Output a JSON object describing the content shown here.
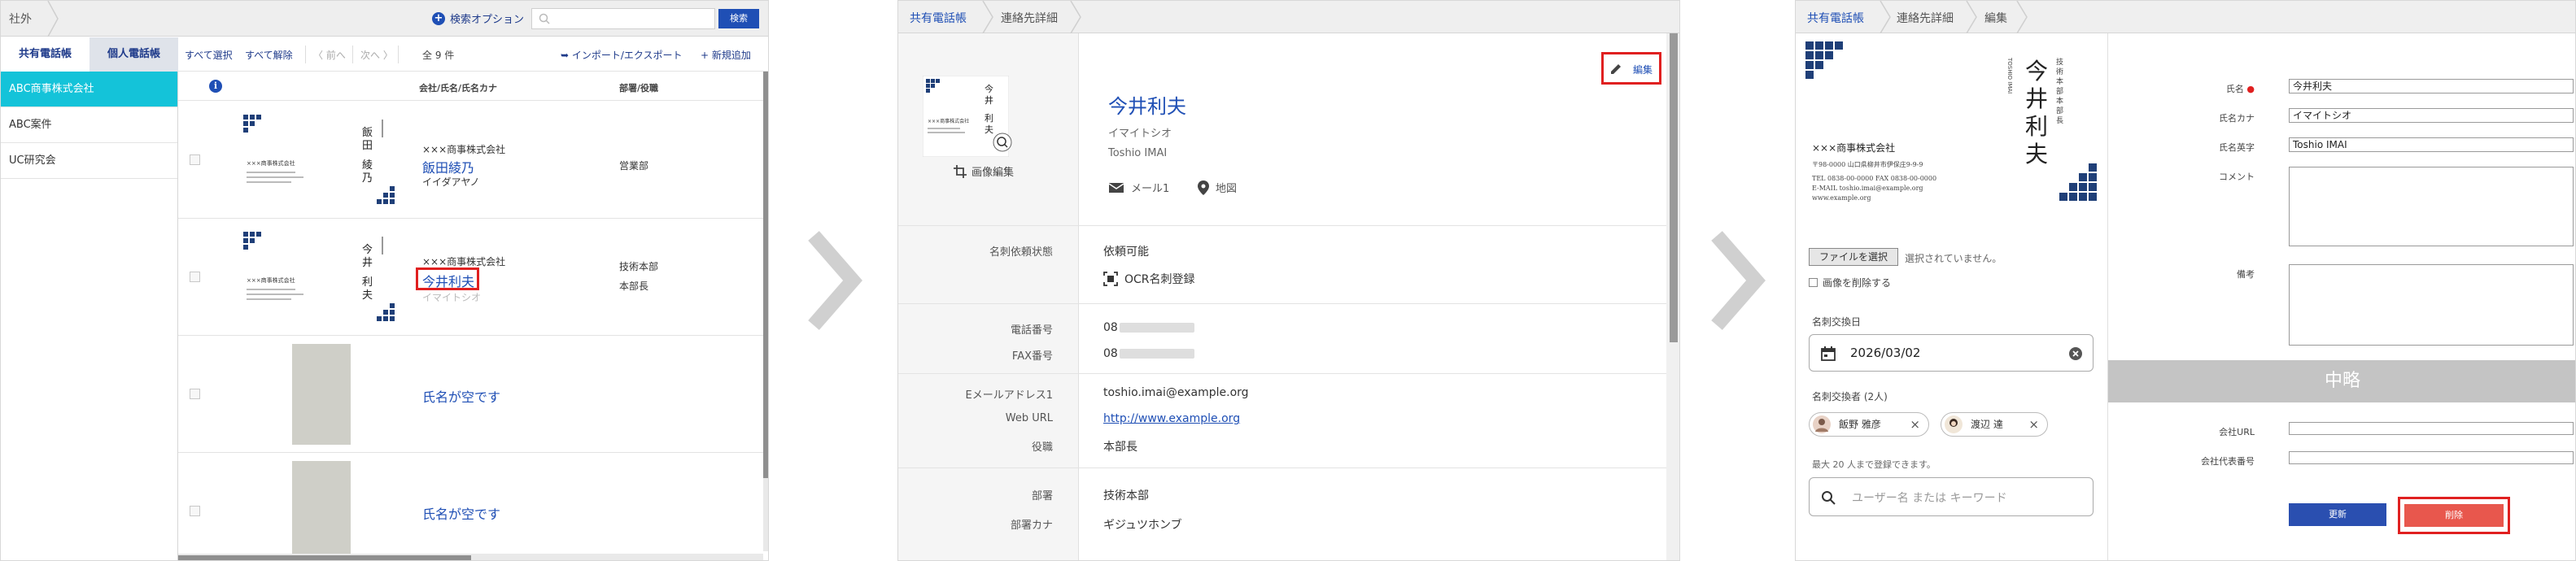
{
  "panel1": {
    "breadcrumb": "社外",
    "search_option_label": "検索オプション",
    "search_button": "検索",
    "tabs": [
      "共有電話帳",
      "個人電話帳"
    ],
    "sidebar": [
      "ABC商事株式会社",
      "ABC案件",
      "UC研究会"
    ],
    "toolbar": {
      "select_all": "すべて選択",
      "deselect_all": "すべて解除",
      "prev": "〈 前へ",
      "next": "次へ 〉",
      "count": "全 9 件",
      "import_export": "インポート/エクスポート",
      "add_new": "新規追加"
    },
    "columns": {
      "company": "会社/氏名/氏名カナ",
      "dept": "部署/役職"
    },
    "rows": [
      {
        "company": "×××商事株式会社",
        "name": "飯田綾乃",
        "kana": "イイダアヤノ",
        "dept": "営業部",
        "title": "",
        "card_name": "飯田 綾乃"
      },
      {
        "company": "×××商事株式会社",
        "name": "今井利夫",
        "kana": "イマイトシオ",
        "dept": "技術本部",
        "title": "本部長",
        "card_name": "今井 利夫"
      },
      {
        "company": "",
        "name": "氏名が空です",
        "kana": "",
        "dept": "",
        "title": ""
      },
      {
        "company": "",
        "name": "氏名が空です",
        "kana": "",
        "dept": "",
        "title": ""
      }
    ]
  },
  "panel2": {
    "breadcrumb": [
      "共有電話帳",
      "連絡先詳細"
    ],
    "edit": "編集",
    "image_edit": "画像編集",
    "name": "今井利夫",
    "kana": "イマイトシオ",
    "romaji": "Toshio IMAI",
    "mail": "メール1",
    "map": "地図",
    "fields": [
      {
        "label": "名刺依頼状態",
        "value": "依頼可能"
      },
      {
        "label": "",
        "value": "OCR名刺登録"
      },
      {
        "label": "電話番号",
        "value": "08"
      },
      {
        "label": "FAX番号",
        "value": "08"
      },
      {
        "label": "Eメールアドレス1",
        "value": "toshio.imai@example.org"
      },
      {
        "label": "Web URL",
        "value": "http://www.example.org"
      },
      {
        "label": "役職",
        "value": "本部長"
      },
      {
        "label": "部署",
        "value": "技術本部"
      },
      {
        "label": "部署カナ",
        "value": "ギジュツホンブ"
      }
    ]
  },
  "panel3": {
    "breadcrumb": [
      "共有電話帳",
      "連絡先詳細",
      "編集"
    ],
    "card": {
      "company": "×××商事株式会社",
      "addr": "〒98-0000 山口県柳井市伊保庄9-9-9",
      "tel": "TEL 0838-00-0000  FAX 0838-00-0000",
      "email": "E-MAIL toshio.imai@example.org",
      "web": "www.example.org",
      "name": "今井 利夫",
      "dept_title": "技術本部 本部長",
      "romaji": "TOSHIO IMAI"
    },
    "file_button": "ファイルを選択",
    "file_status": "選択されていません。",
    "delete_image": "画像を削除する",
    "exchange_date_label": "名刺交換日",
    "exchange_date": "2026/03/02",
    "exchangers_label": "名刺交換者 (2人)",
    "exchangers": [
      "飯野 雅彦",
      "渡辺 達"
    ],
    "max_note": "最大 20 人まで登録できます。",
    "user_search_placeholder": "ユーザー名 または キーワード",
    "form": [
      {
        "label": "氏名",
        "value": "今井利夫",
        "required": true
      },
      {
        "label": "氏名カナ",
        "value": "イマイトシオ"
      },
      {
        "label": "氏名英字",
        "value": "Toshio IMAI"
      },
      {
        "label": "コメント",
        "value": ""
      },
      {
        "label": "備考",
        "value": ""
      }
    ],
    "omitted": "中略",
    "company_url_label": "会社URL",
    "company_phone_label": "会社代表番号",
    "update": "更新",
    "delete": "削除"
  },
  "colors": {
    "accent": "#1f4fb5",
    "selected": "#14c3d9",
    "highlight": "#e02020",
    "danger": "#e8574d"
  }
}
